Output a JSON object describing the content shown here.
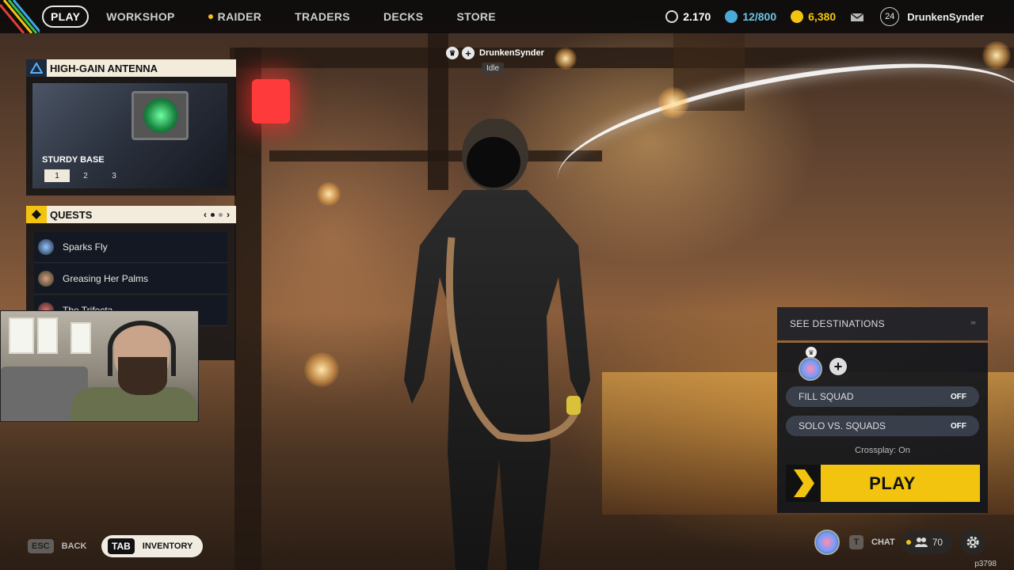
{
  "nav": {
    "play": "PLAY",
    "workshop": "WORKSHOP",
    "raider": "RAIDER",
    "traders": "TRADERS",
    "decks": "DECKS",
    "store": "STORE"
  },
  "currencies": {
    "cred": "2.170",
    "tokens": "12/800",
    "coins": "6,380"
  },
  "user": {
    "level": "24",
    "name": "DrunkenSynder"
  },
  "antenna": {
    "title": "HIGH-GAIN ANTENNA",
    "subtitle": "STURDY BASE",
    "tabs": [
      "1",
      "2",
      "3"
    ]
  },
  "quests": {
    "title": "QUESTS",
    "items": [
      "Sparks Fly",
      "Greasing Her Palms",
      "The Trifecta"
    ]
  },
  "player_tag": {
    "name": "DrunkenSynder",
    "status": "Idle"
  },
  "play_panel": {
    "destinations": "SEE DESTINATIONS",
    "fill_squad": "FILL SQUAD",
    "fill_squad_value": "OFF",
    "solo_vs_squads": "SOLO VS. SQUADS",
    "solo_vs_squads_value": "OFF",
    "crossplay": "Crossplay: On",
    "play": "PLAY"
  },
  "bottom": {
    "esc_key": "ESC",
    "back": "BACK",
    "tab_key": "TAB",
    "inventory": "INVENTORY",
    "chat_key": "T",
    "chat": "CHAT",
    "friends_count": "70",
    "build": "p3798"
  },
  "colors": {
    "accent": "#f2c40f",
    "panel_header": "#f3ecdc"
  }
}
